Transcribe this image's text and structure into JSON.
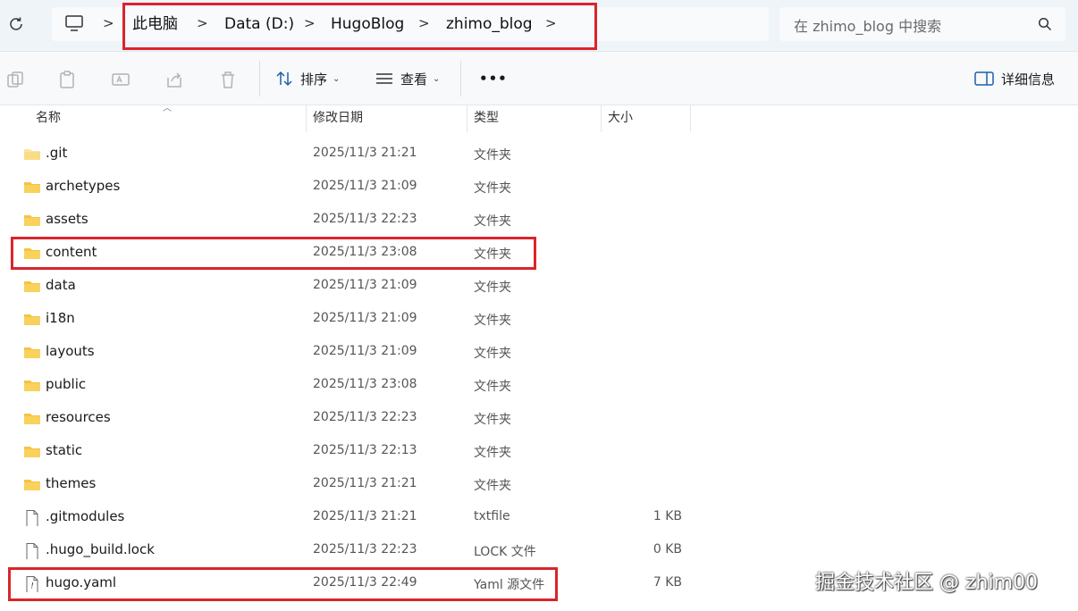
{
  "address": {
    "crumbs": [
      "此电脑",
      "Data (D:)",
      "HugoBlog",
      "zhimo_blog"
    ],
    "separator": ">",
    "search_placeholder": "在 zhimo_blog 中搜索"
  },
  "toolbar": {
    "sort_label": "排序",
    "view_label": "查看",
    "more_label": "•••",
    "details_label": "详细信息"
  },
  "columns": {
    "name": "名称",
    "modified": "修改日期",
    "type": "类型",
    "size": "大小"
  },
  "files": [
    {
      "name": ".git",
      "modified": "2025/11/3 21:21",
      "type": "文件夹",
      "size": "",
      "icon": "folder-hidden-icon"
    },
    {
      "name": "archetypes",
      "modified": "2025/11/3 21:09",
      "type": "文件夹",
      "size": "",
      "icon": "folder-icon"
    },
    {
      "name": "assets",
      "modified": "2025/11/3 22:23",
      "type": "文件夹",
      "size": "",
      "icon": "folder-icon"
    },
    {
      "name": "content",
      "modified": "2025/11/3 23:08",
      "type": "文件夹",
      "size": "",
      "icon": "folder-icon"
    },
    {
      "name": "data",
      "modified": "2025/11/3 21:09",
      "type": "文件夹",
      "size": "",
      "icon": "folder-icon"
    },
    {
      "name": "i18n",
      "modified": "2025/11/3 21:09",
      "type": "文件夹",
      "size": "",
      "icon": "folder-icon"
    },
    {
      "name": "layouts",
      "modified": "2025/11/3 21:09",
      "type": "文件夹",
      "size": "",
      "icon": "folder-icon"
    },
    {
      "name": "public",
      "modified": "2025/11/3 23:08",
      "type": "文件夹",
      "size": "",
      "icon": "folder-icon"
    },
    {
      "name": "resources",
      "modified": "2025/11/3 22:23",
      "type": "文件夹",
      "size": "",
      "icon": "folder-icon"
    },
    {
      "name": "static",
      "modified": "2025/11/3 22:13",
      "type": "文件夹",
      "size": "",
      "icon": "folder-icon"
    },
    {
      "name": "themes",
      "modified": "2025/11/3 21:21",
      "type": "文件夹",
      "size": "",
      "icon": "folder-icon"
    },
    {
      "name": ".gitmodules",
      "modified": "2025/11/3 21:21",
      "type": "txtfile",
      "size": "1 KB",
      "icon": "file-icon"
    },
    {
      "name": ".hugo_build.lock",
      "modified": "2025/11/3 22:23",
      "type": "LOCK 文件",
      "size": "0 KB",
      "icon": "file-icon"
    },
    {
      "name": "hugo.yaml",
      "modified": "2025/11/3 22:49",
      "type": "Yaml 源文件",
      "size": "7 KB",
      "icon": "yaml-file-icon"
    }
  ],
  "watermark": "掘金技术社区 @ zhim00",
  "colors": {
    "highlight": "#d9252b",
    "folder": "#f5c343"
  }
}
